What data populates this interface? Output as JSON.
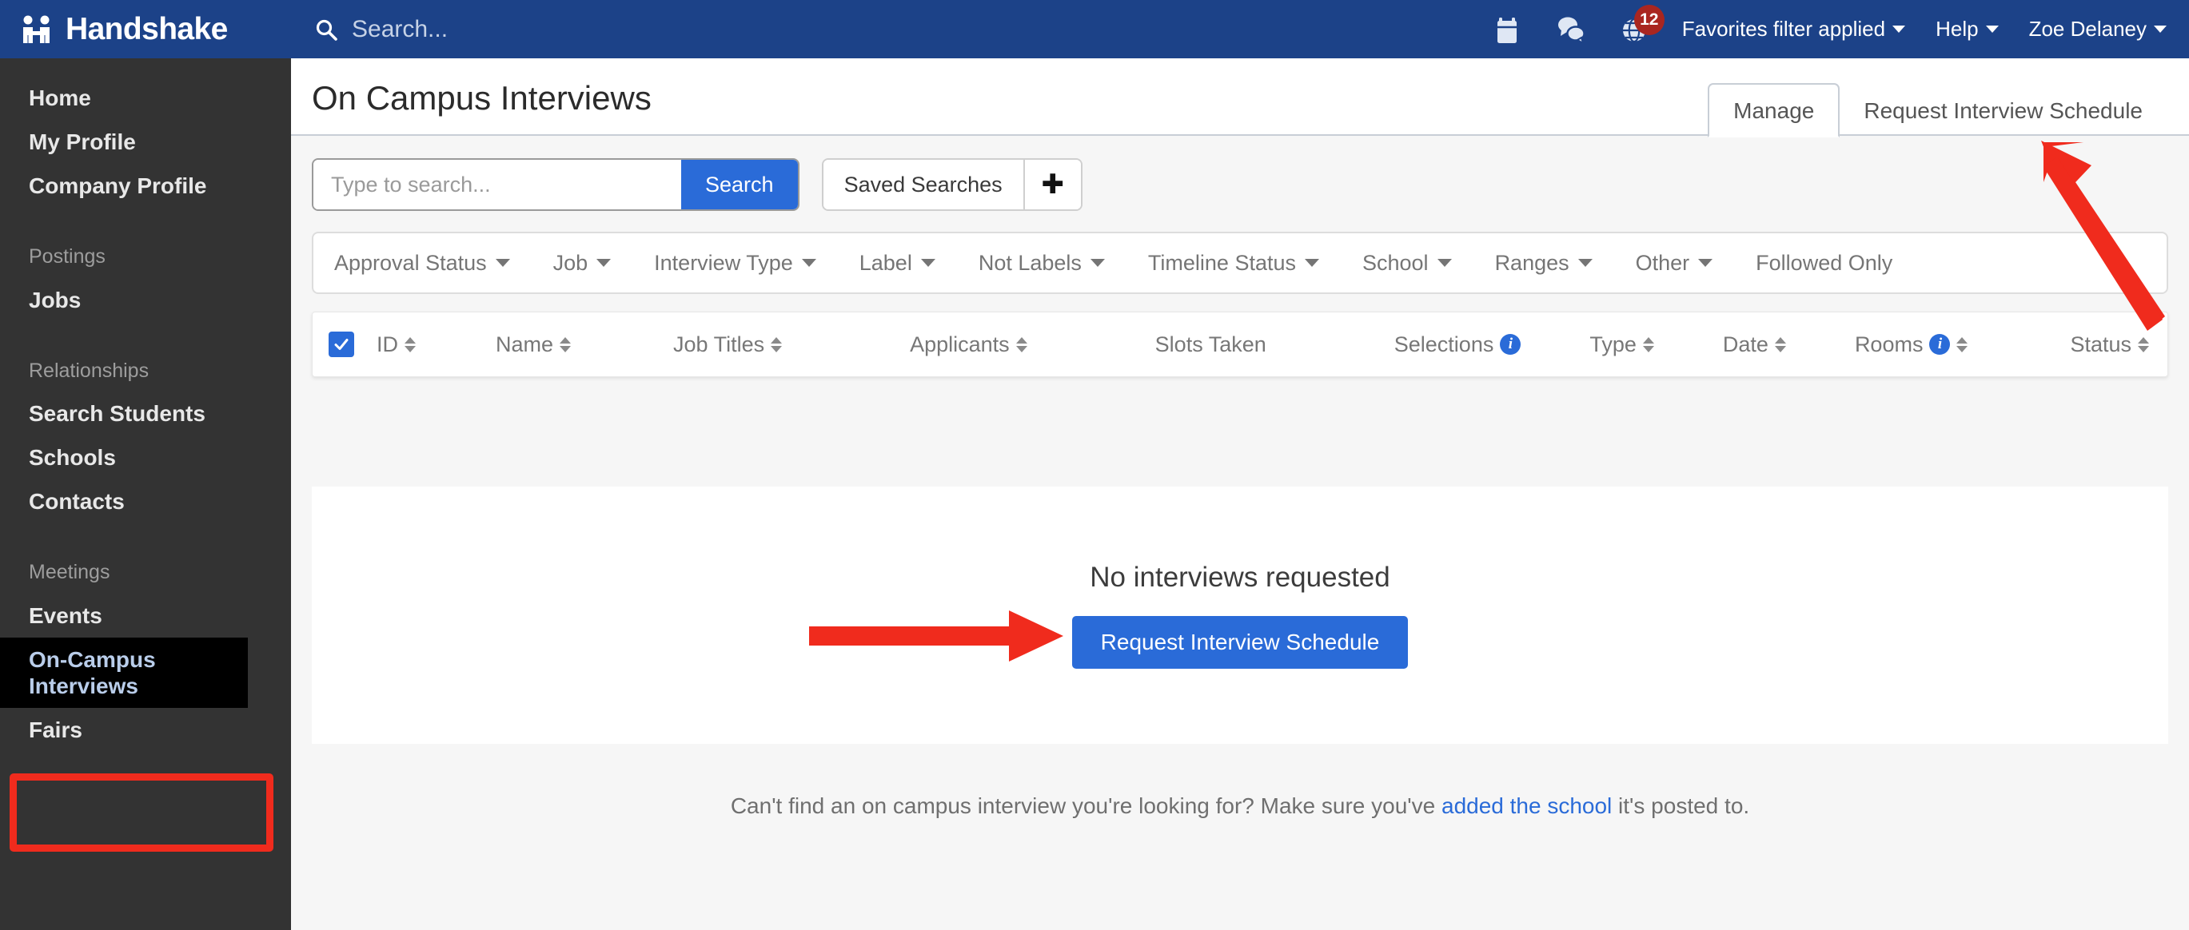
{
  "brand": {
    "name": "Handshake",
    "logo_icon": "handshake-logo-icon"
  },
  "topnav": {
    "search_label": "Search...",
    "search_icon": "search-icon",
    "calendar_icon": "calendar-icon",
    "messages_icon": "chat-bubbles-icon",
    "notifications_icon": "globe-icon",
    "notifications_count": "12",
    "favorites_filter": "Favorites filter applied",
    "help": "Help",
    "user": "Zoe Delaney",
    "bg_color": "#1c4288",
    "badge_color": "#a92620"
  },
  "sidebar": {
    "bg_color": "#333333",
    "active_color": "#b9cdea",
    "items": [
      {
        "label": "Home",
        "type": "link",
        "active": false
      },
      {
        "label": "My Profile",
        "type": "link",
        "active": false
      },
      {
        "label": "Company Profile",
        "type": "link",
        "active": false
      },
      {
        "label": "Postings",
        "type": "group",
        "active": false
      },
      {
        "label": "Jobs",
        "type": "link",
        "active": false
      },
      {
        "label": "Relationships",
        "type": "group",
        "active": false
      },
      {
        "label": "Search Students",
        "type": "link",
        "active": false
      },
      {
        "label": "Schools",
        "type": "link",
        "active": false
      },
      {
        "label": "Contacts",
        "type": "link",
        "active": false
      },
      {
        "label": "Meetings",
        "type": "group",
        "active": false
      },
      {
        "label": "Events",
        "type": "link",
        "active": false
      },
      {
        "label": "On-Campus Interviews",
        "type": "link",
        "active": true
      },
      {
        "label": "Fairs",
        "type": "link",
        "active": false
      }
    ]
  },
  "page": {
    "title": "On Campus Interviews",
    "tabs": [
      {
        "label": "Manage",
        "active": true
      },
      {
        "label": "Request Interview Schedule",
        "active": false
      }
    ]
  },
  "search": {
    "placeholder": "Type to search...",
    "value": "",
    "button_label": "Search",
    "saved_label": "Saved Searches",
    "add_icon": "plus-icon",
    "accent_color": "#2a6bd8"
  },
  "filters": [
    {
      "label": "Approval Status",
      "has_caret": true
    },
    {
      "label": "Job",
      "has_caret": true
    },
    {
      "label": "Interview Type",
      "has_caret": true
    },
    {
      "label": "Label",
      "has_caret": true
    },
    {
      "label": "Not Labels",
      "has_caret": true
    },
    {
      "label": "Timeline Status",
      "has_caret": true
    },
    {
      "label": "School",
      "has_caret": true
    },
    {
      "label": "Ranges",
      "has_caret": true
    },
    {
      "label": "Other",
      "has_caret": true
    },
    {
      "label": "Followed Only",
      "has_caret": false
    }
  ],
  "table": {
    "select_all_checked": true,
    "columns": [
      {
        "label": "ID",
        "sortable": true,
        "info": false
      },
      {
        "label": "Name",
        "sortable": true,
        "info": false
      },
      {
        "label": "Job Titles",
        "sortable": true,
        "info": false
      },
      {
        "label": "Applicants",
        "sortable": true,
        "info": false
      },
      {
        "label": "Slots Taken",
        "sortable": false,
        "info": false
      },
      {
        "label": "Selections",
        "sortable": false,
        "info": true
      },
      {
        "label": "Type",
        "sortable": true,
        "info": false
      },
      {
        "label": "Date",
        "sortable": true,
        "info": false
      },
      {
        "label": "Rooms",
        "sortable": true,
        "info": true
      },
      {
        "label": "Status",
        "sortable": true,
        "info": false
      }
    ],
    "rows": []
  },
  "empty_state": {
    "title": "No interviews requested",
    "button_label": "Request Interview Schedule"
  },
  "footer": {
    "text_before": "Can't find an on campus interview you're looking for? Make sure you've ",
    "link_text": "added the school",
    "text_after": " it's posted to."
  },
  "annotations": {
    "highlight_color": "#f02b1d",
    "box_target": "sidebar-item-on-campus-interviews",
    "arrow_1_target": "request-interview-schedule-button",
    "arrow_2_target": "tab-request-interview-schedule"
  }
}
